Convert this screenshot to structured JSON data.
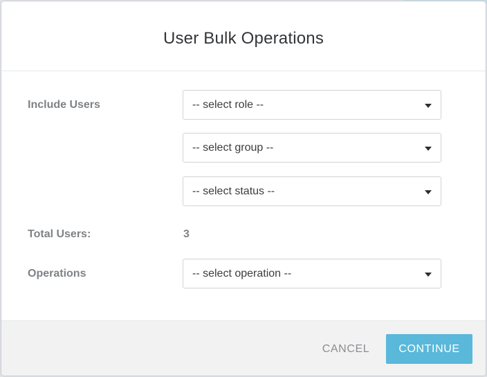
{
  "dialog": {
    "title": "User Bulk Operations"
  },
  "form": {
    "include_users_label": "Include Users",
    "role_select": {
      "selected": "-- select role --"
    },
    "group_select": {
      "selected": "-- select group --"
    },
    "status_select": {
      "selected": "-- select status --"
    },
    "total_users_label": "Total Users:",
    "total_users_value": "3",
    "operations_label": "Operations",
    "operation_select": {
      "selected": "-- select operation --"
    }
  },
  "footer": {
    "cancel_label": "CANCEL",
    "continue_label": "CONTINUE"
  },
  "colors": {
    "primary": "#5ab8da",
    "label_gray": "#7f8285",
    "footer_bg": "#f2f2f3"
  },
  "icons": {
    "dropdown": "caret-down-icon"
  }
}
